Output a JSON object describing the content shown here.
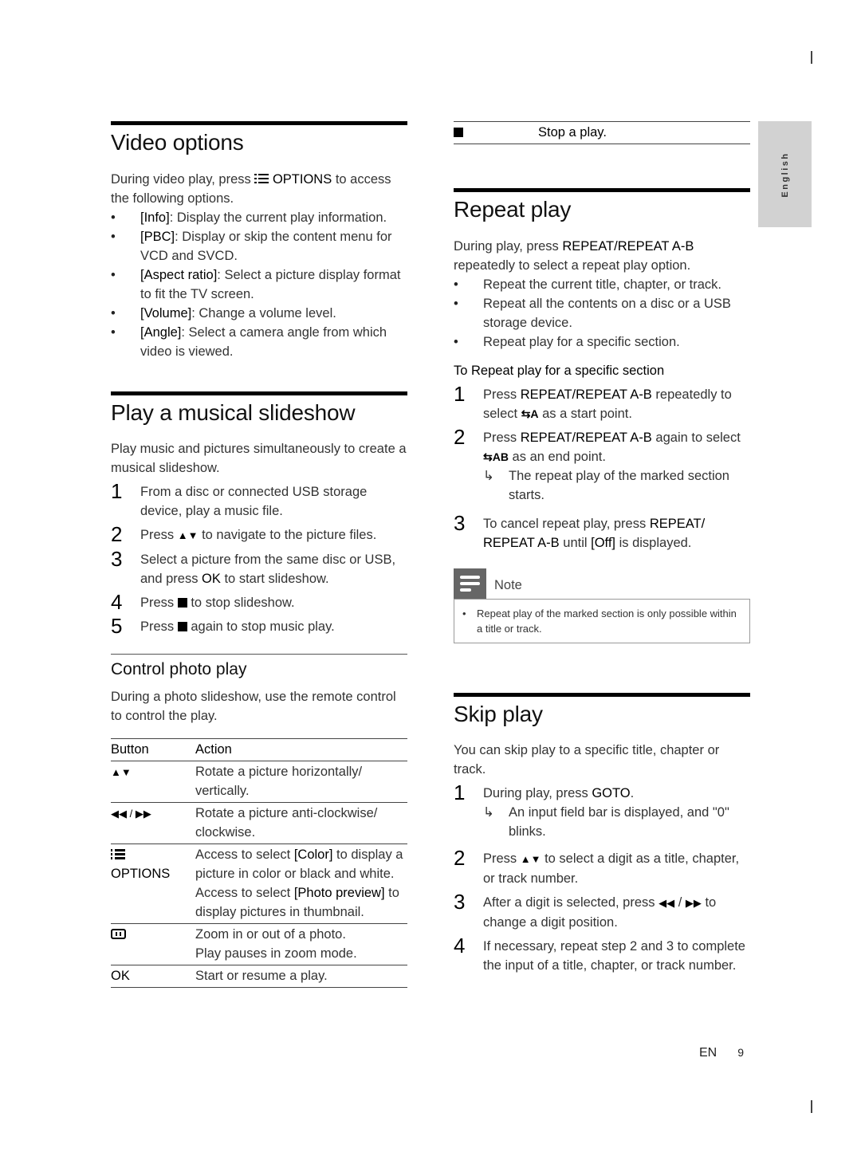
{
  "side_tab": {
    "label": "English"
  },
  "footer": {
    "lang": "EN",
    "page": "9"
  },
  "icons": {
    "options": "options-list-icon",
    "up_down": "▲▼",
    "rew_ff_left": "◀◀",
    "rew_ff_right": "▶▶",
    "stop": "stop-square-icon",
    "arrow": "↳",
    "repeat": "⇆",
    "zoom": "zoom-icon",
    "note": "note-icon"
  },
  "video_options": {
    "title": "Video options",
    "intro_a": "During video play, press ",
    "intro_key": "OPTIONS",
    "intro_b": " to access the following options.",
    "items": [
      {
        "key": "[Info]",
        "text": ": Display the current play information."
      },
      {
        "key": "[PBC]",
        "text": ": Display or skip the content menu for VCD and SVCD."
      },
      {
        "key": "[Aspect ratio]",
        "text": ": Select a picture display format to fit the TV screen."
      },
      {
        "key": "[Volume]",
        "text": ": Change a volume level."
      },
      {
        "key": "[Angle]",
        "text": ": Select a camera angle from which video is viewed."
      }
    ]
  },
  "slideshow": {
    "title": "Play a musical slideshow",
    "intro": "Play music and pictures simultaneously to create a musical slideshow.",
    "steps": [
      {
        "num": "1",
        "text": "From a disc or connected USB storage device, play a music file."
      },
      {
        "num": "2",
        "a": "Press ",
        "b": " to navigate to the picture files."
      },
      {
        "num": "3",
        "a": "Select a picture from the same disc or USB, and press ",
        "key": "OK",
        "b": " to start slideshow."
      },
      {
        "num": "4",
        "a": "Press ",
        "b": " to stop slideshow."
      },
      {
        "num": "5",
        "a": "Press ",
        "b": " again to stop music play."
      }
    ]
  },
  "photo_control": {
    "title": "Control photo play",
    "intro": "During a photo slideshow, use the remote control to control the play.",
    "headers": {
      "button": "Button",
      "action": "Action"
    },
    "rows": [
      {
        "button": "▲▼",
        "action": "Rotate a picture horizontally/ vertically."
      },
      {
        "button": "◀◀ / ▶▶",
        "action": "Rotate a picture anti-clockwise/ clockwise."
      },
      {
        "button": "OPTIONS",
        "action_a": "Access to select ",
        "key1": "[Color]",
        "action_b": " to display a picture in color or black and white.",
        "action_c": "Access to select ",
        "key2": "[Photo preview]",
        "action_d": " to display pictures in thumbnail."
      },
      {
        "button": "",
        "action_a": "Zoom in or out of a photo.",
        "action_b": "Play pauses in zoom mode."
      },
      {
        "button": "OK",
        "action": "Start or resume a play."
      },
      {
        "button": "",
        "action": "Stop a play."
      }
    ]
  },
  "repeat_play": {
    "title": "Repeat play",
    "intro_a": "During play, press ",
    "intro_key": "REPEAT/REPEAT A-B",
    "intro_b": " repeatedly to select a repeat play option.",
    "items": [
      "Repeat the current title, chapter, or track.",
      "Repeat all the contents on a disc or a USB storage device.",
      "Repeat play for a specific section."
    ],
    "subhead": "To Repeat play for a specific section",
    "steps": [
      {
        "num": "1",
        "a": "Press ",
        "key": "REPEAT/REPEAT A-B",
        "b": "  repeatedly to select ",
        "mark": "A",
        "c": " as a start point."
      },
      {
        "num": "2",
        "a": "Press ",
        "key": "REPEAT/REPEAT A-B",
        "b": "  again to select ",
        "mark": "AB",
        "c": " as an end point.",
        "result": "The repeat play of the marked section starts."
      },
      {
        "num": "3",
        "a": "To cancel repeat play, press ",
        "key": "REPEAT/ REPEAT A-B",
        "b": "  until ",
        "key2": "[Off]",
        "c": " is displayed."
      }
    ],
    "note": {
      "label": "Note",
      "text": "Repeat play of the marked section is only possible within a title or track."
    }
  },
  "skip_play": {
    "title": "Skip play",
    "intro": "You can skip play to a specific title, chapter or track.",
    "steps": [
      {
        "num": "1",
        "a": "During play, press ",
        "key": "GOTO",
        "b": ".",
        "result": "An input field bar is displayed, and \"0\" blinks."
      },
      {
        "num": "2",
        "a": "Press ",
        "b": " to select a digit as a title, chapter, or track number."
      },
      {
        "num": "3",
        "a": "After a digit is selected, press ",
        "b": " to change a digit position."
      },
      {
        "num": "4",
        "text": "If necessary, repeat step 2 and 3 to complete the input of a title, chapter, or track number."
      }
    ]
  }
}
